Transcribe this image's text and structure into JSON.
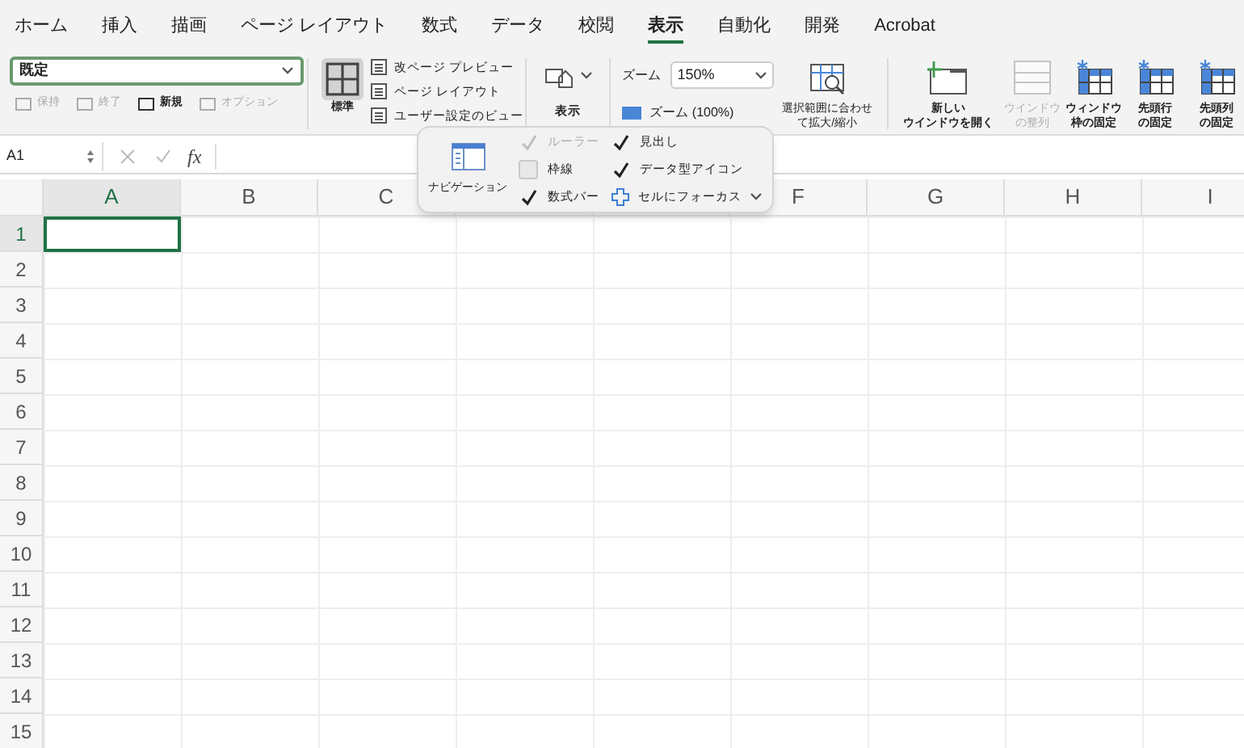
{
  "tabs": [
    {
      "label": "ホーム",
      "selected": false
    },
    {
      "label": "挿入",
      "selected": false
    },
    {
      "label": "描画",
      "selected": false
    },
    {
      "label": "ページ レイアウト",
      "selected": false
    },
    {
      "label": "数式",
      "selected": false
    },
    {
      "label": "データ",
      "selected": false
    },
    {
      "label": "校閲",
      "selected": false
    },
    {
      "label": "表示",
      "selected": true
    },
    {
      "label": "自動化",
      "selected": false
    },
    {
      "label": "開発",
      "selected": false
    },
    {
      "label": "Acrobat",
      "selected": false
    }
  ],
  "sheet_view": {
    "value": "既定",
    "buttons": [
      {
        "label": "保持",
        "disabled": true
      },
      {
        "label": "終了",
        "disabled": true
      },
      {
        "label": "新規",
        "disabled": false
      },
      {
        "label": "オプション",
        "disabled": true
      }
    ]
  },
  "workbook_views": {
    "normal": {
      "label": "標準",
      "selected": true
    },
    "items": [
      {
        "label": "改ページ プレビュー"
      },
      {
        "label": "ページ レイアウト"
      },
      {
        "label": "ユーザー設定のビュー"
      }
    ]
  },
  "show_button": {
    "label": "表示"
  },
  "zoom": {
    "label": "ズーム",
    "value": "150%",
    "reset": "ズーム (100%)",
    "fit": [
      "選択範囲に合わせ",
      "て拡大/縮小"
    ]
  },
  "window_buttons": [
    {
      "lines": [
        "新しい",
        "ウインドウを開く"
      ],
      "disabled": false,
      "kind": "new"
    },
    {
      "lines": [
        "ウインドウ",
        "の整列"
      ],
      "disabled": true,
      "kind": "arrange"
    },
    {
      "lines": [
        "ウィンドウ",
        "枠の固定"
      ],
      "disabled": false,
      "kind": "freeze"
    },
    {
      "lines": [
        "先頭行",
        "の固定"
      ],
      "disabled": false,
      "kind": "freeze"
    },
    {
      "lines": [
        "先頭列",
        "の固定"
      ],
      "disabled": false,
      "kind": "freeze"
    }
  ],
  "formula_bar": {
    "name_box": "A1",
    "fx": "fx"
  },
  "columns": [
    {
      "label": "A",
      "selected": true
    },
    {
      "label": "B",
      "selected": false
    },
    {
      "label": "C",
      "selected": false
    },
    {
      "selected": false
    },
    {
      "selected": false
    },
    {
      "label": "F",
      "selected": false
    },
    {
      "label": "G",
      "selected": false
    },
    {
      "label": "H",
      "selected": false
    },
    {
      "label": "I",
      "selected": false
    }
  ],
  "rows": [
    {
      "label": "1",
      "selected": true
    },
    {
      "label": "2",
      "selected": false
    },
    {
      "label": "3",
      "selected": false
    },
    {
      "label": "4",
      "selected": false
    },
    {
      "label": "5",
      "selected": false
    },
    {
      "label": "6",
      "selected": false
    },
    {
      "label": "7",
      "selected": false
    },
    {
      "label": "8",
      "selected": false
    },
    {
      "label": "9",
      "selected": false
    },
    {
      "label": "10",
      "selected": false
    },
    {
      "label": "11",
      "selected": false
    },
    {
      "label": "12",
      "selected": false
    },
    {
      "label": "13",
      "selected": false
    },
    {
      "label": "14",
      "selected": false
    },
    {
      "label": "15",
      "selected": false
    }
  ],
  "show_popup": {
    "navigation": "ナビゲーション",
    "options": [
      {
        "label": "ルーラー",
        "checked": true,
        "disabled": true,
        "kind": "checkbox"
      },
      {
        "label": "枠線",
        "checked": false,
        "disabled": false,
        "kind": "checkbox"
      },
      {
        "label": "数式バー",
        "checked": true,
        "disabled": false,
        "kind": "checkbox"
      },
      {
        "label": "見出し",
        "checked": true,
        "disabled": false,
        "kind": "checkbox"
      },
      {
        "label": "データ型アイコン",
        "checked": true,
        "disabled": false,
        "kind": "checkbox"
      },
      {
        "label": "セルにフォーカス",
        "kind": "dropdown"
      }
    ]
  }
}
